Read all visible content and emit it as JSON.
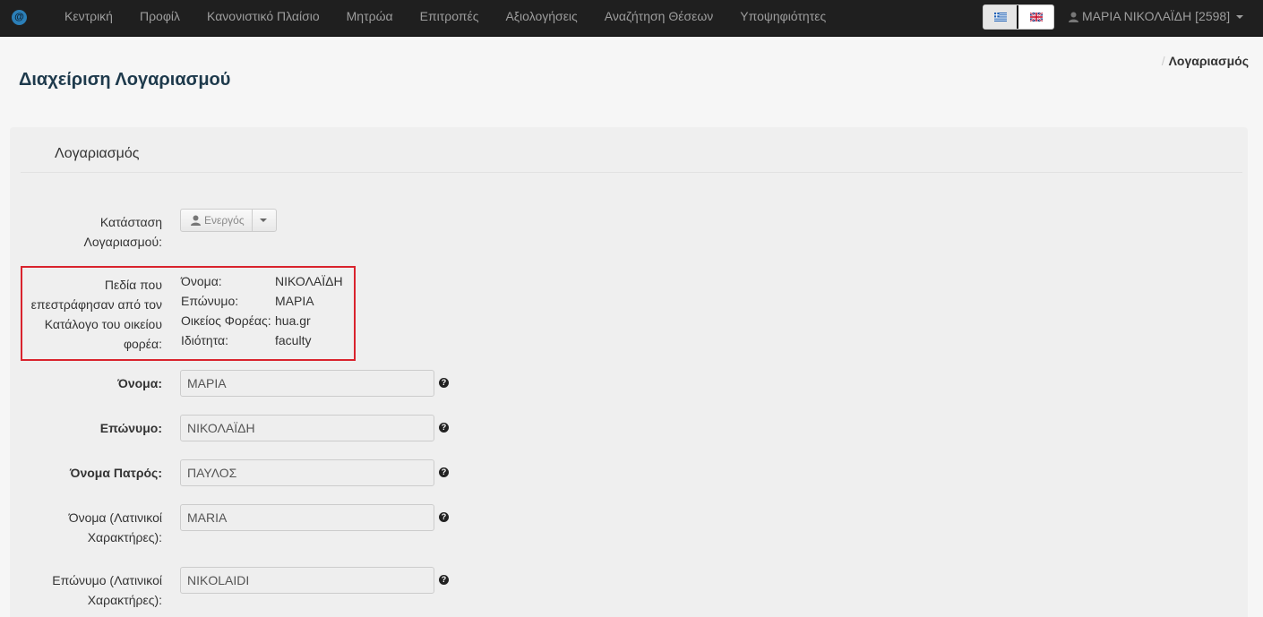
{
  "navbar": {
    "brand_symbol": "@",
    "items": [
      "Κεντρική",
      "Προφίλ",
      "Κανονιστικό Πλαίσιο",
      "Μητρώα",
      "Επιτροπές",
      "Αξιολογήσεις",
      "Αναζήτηση Θέσεων",
      "Υποψηφιότητες"
    ],
    "user_label": "ΜΑΡΙΑ ΝΙΚΟΛΑΪΔΗ [2598]"
  },
  "page": {
    "title": "Διαχείριση Λογαριασμού",
    "breadcrumb_sep": "/",
    "breadcrumb_active": "Λογαριασμός"
  },
  "panel": {
    "title": "Λογαριασμός",
    "status_label_line1": "Κατάσταση",
    "status_label_line2": "Λογαριασμού:",
    "status_value": "Ενεργός",
    "directory_label_lines": [
      "Πεδία που",
      "επεστράφησαν από τον",
      "Κατάλογο του οικείου",
      "φορέα:"
    ],
    "directory_fields": [
      {
        "key": "Όνομα:",
        "value": "ΝΙΚΟΛΑΪΔΗ"
      },
      {
        "key": "Επώνυμο:",
        "value": "ΜΑΡΙΑ"
      },
      {
        "key": "Οικείος Φορέας:",
        "value": "hua.gr"
      },
      {
        "key": "Ιδιότητα:",
        "value": "faculty"
      }
    ],
    "fields": {
      "first_name": {
        "label": "Όνομα:",
        "value": "ΜΑΡΙΑ"
      },
      "last_name": {
        "label": "Επώνυμο:",
        "value": "ΝΙΚΟΛΑΪΔΗ"
      },
      "father_name": {
        "label": "Όνομα Πατρός:",
        "value": "ΠΑΥΛΟΣ"
      },
      "first_name_latin": {
        "label_line1": "Όνομα (Λατινικοί",
        "label_line2": "Χαρακτήρες):",
        "value": "MARIA"
      },
      "last_name_latin": {
        "label_line1": "Επώνυμο (Λατινικοί",
        "label_line2": "Χαρακτήρες):",
        "value": "NIKOLAIDI"
      }
    },
    "help_symbol": "?"
  },
  "colors": {
    "navbar_bg": "#1f1f1f",
    "title_color": "#1e3a4c",
    "highlight_border": "#d9232d"
  }
}
